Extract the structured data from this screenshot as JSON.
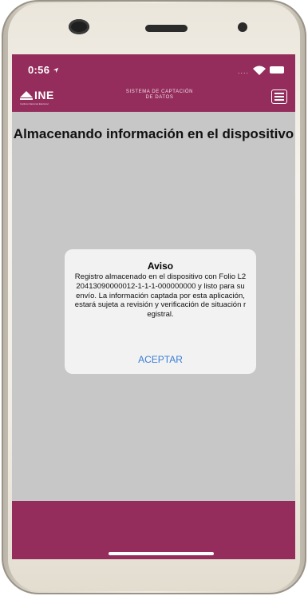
{
  "status_bar": {
    "time": "0:56",
    "location_icon": "location-arrow-icon",
    "signal_text": "....",
    "wifi_icon": "wifi-icon",
    "battery_icon": "battery-icon"
  },
  "app_bar": {
    "logo_text": "INE",
    "logo_subtext": "Instituto Nacional Electoral",
    "title_line1": "SISTEMA DE CAPTACIÓN",
    "title_line2": "DE DATOS",
    "menu_icon": "hamburger-menu-icon",
    "color": "#942d5c"
  },
  "main": {
    "heading": "Almacenando información en el dispositivo"
  },
  "dialog": {
    "title": "Aviso",
    "message": "Registro almacenado en el dispositivo con Folio L220413090000012-1-1-1-000000000 y listo para su envío. La información captada por esta aplicación, estará sujeta a revisión y verificación de situación registral.",
    "button_label": "ACEPTAR",
    "button_color": "#3b7ed6"
  }
}
